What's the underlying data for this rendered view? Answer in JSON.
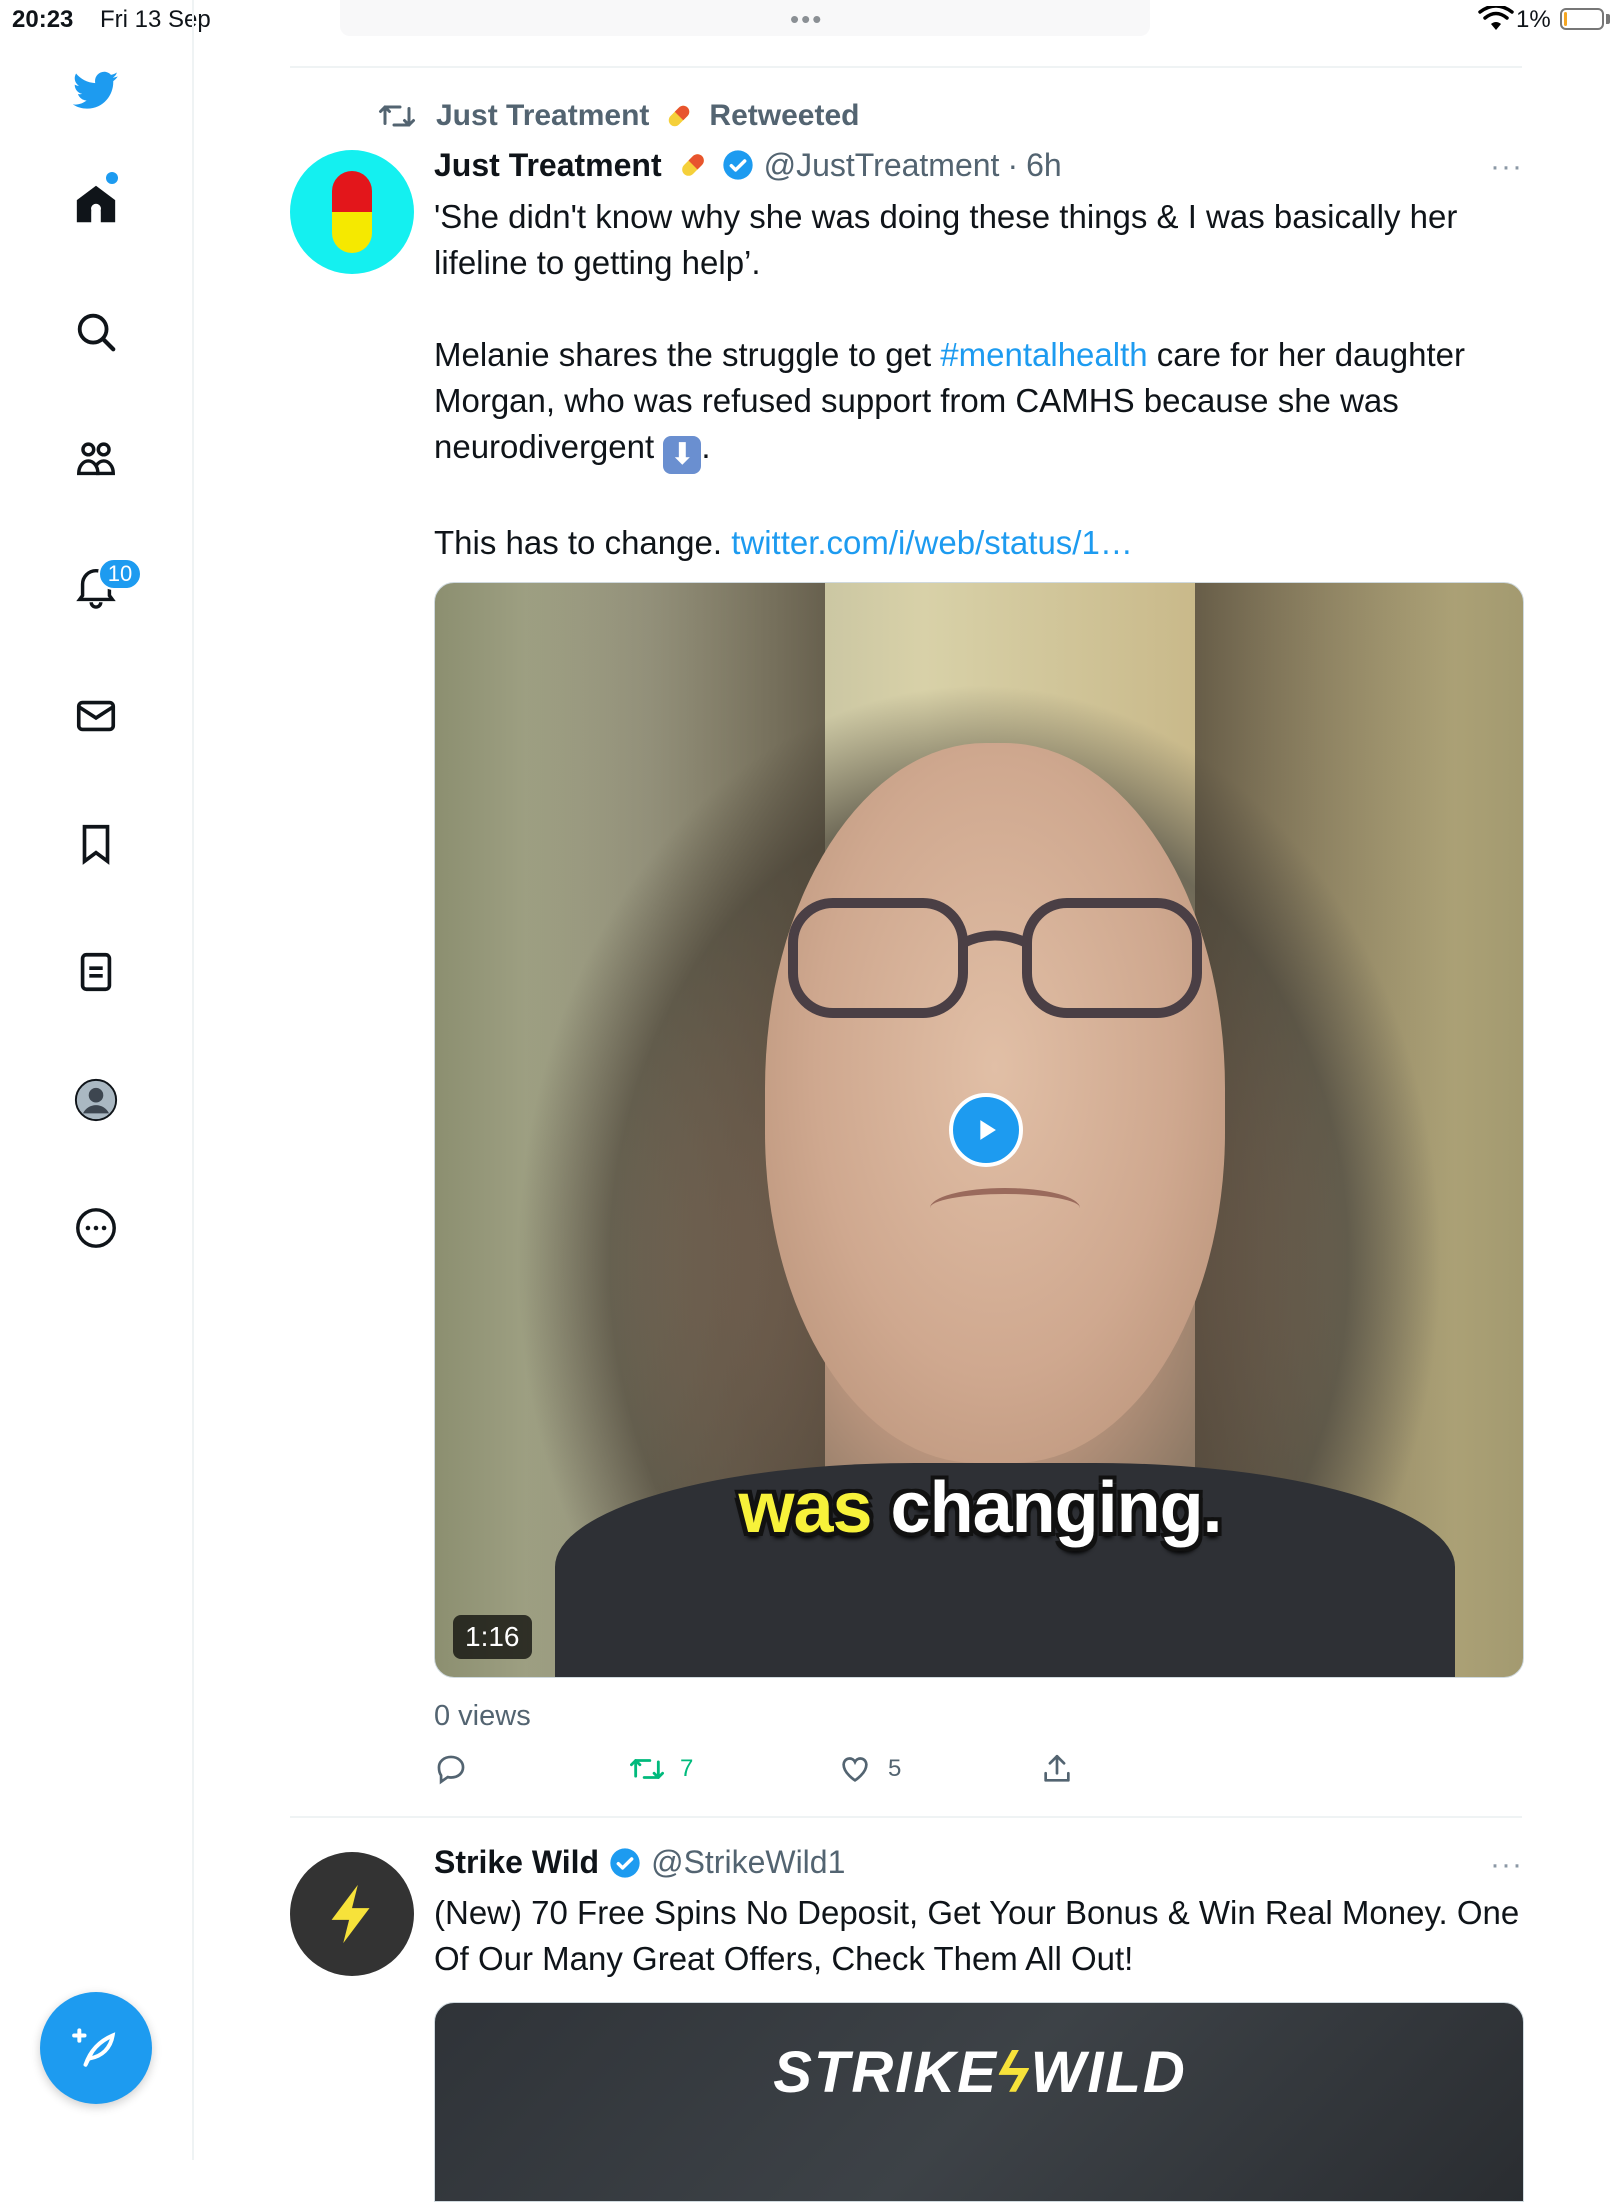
{
  "status_bar": {
    "time": "20:23",
    "date": "Fri 13 Sep",
    "battery_percent": "1%",
    "battery_level": 0.01
  },
  "sidebar": {
    "items": [
      {
        "icon": "twitter-bird-icon"
      },
      {
        "icon": "home-icon"
      },
      {
        "icon": "search-icon"
      },
      {
        "icon": "communities-icon"
      },
      {
        "icon": "notifications-bell-icon"
      },
      {
        "icon": "messages-envelope-icon"
      },
      {
        "icon": "bookmark-icon"
      },
      {
        "icon": "lists-icon"
      },
      {
        "icon": "profile-avatar-icon"
      },
      {
        "icon": "more-options-icon"
      }
    ],
    "notification_count": "10",
    "compose_icon": "compose-feather-icon"
  },
  "tweets": [
    {
      "retweeted_by": "Just Treatment",
      "retweeted_label": "Retweeted",
      "author_name": "Just Treatment",
      "handle": "@JustTreatment",
      "separator": "·",
      "time_ago": "6h",
      "more": "···",
      "text_p1": "'She didn't know why she was doing these things & I was basically her lifeline to getting help’.",
      "text_p2_a": "Melanie shares the struggle to get ",
      "text_p2_hashtag": "#mentalhealth",
      "text_p2_b": " care for her daughter Morgan, who was refused support from CAMHS because she was neurodivergent ",
      "text_p2_emoji": "⬇",
      "text_p2_end": ".",
      "text_p3_a": "This has to change. ",
      "text_p3_link": "twitter.com/i/web/status/1…",
      "video_caption_highlight": "was",
      "video_caption_rest": " changing.",
      "video_duration": "1:16",
      "views": "0 views",
      "reply_count": "",
      "retweet_count": "7",
      "like_count": "5",
      "accent_color": "#1d9bf0",
      "retweet_color": "#00ba7c"
    },
    {
      "author_name": "Strike Wild",
      "handle": "@StrikeWild1",
      "more": "···",
      "text": "(New) 70 Free Spins No Deposit, Get Your Bonus & Win Real Money. One Of Our Many Great Offers, Check Them All Out!",
      "ad_logo_a": "STRIKE",
      "ad_logo_b": "WILD"
    }
  ]
}
